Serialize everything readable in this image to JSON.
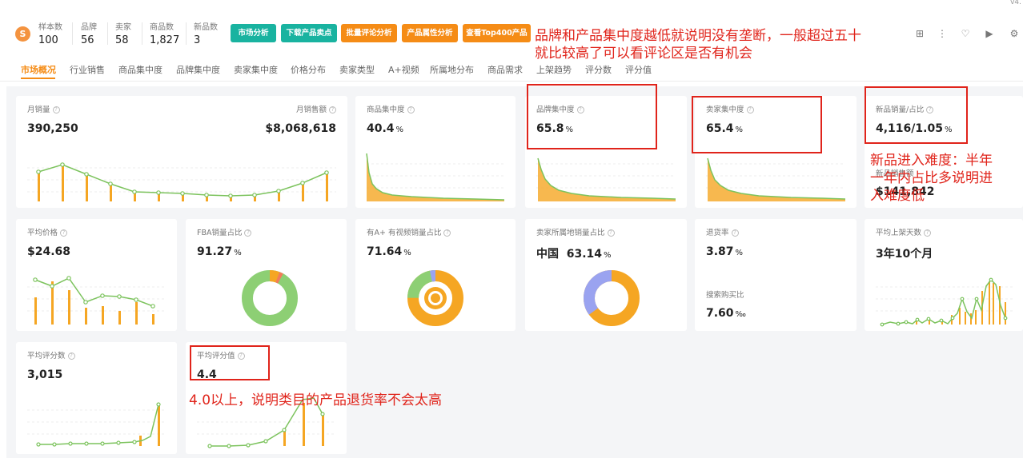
{
  "version": "v4.",
  "header": {
    "stats": [
      {
        "label": "样本数",
        "value": "100"
      },
      {
        "label": "品牌",
        "value": "56"
      },
      {
        "label": "卖家",
        "value": "58"
      },
      {
        "label": "商品数",
        "value": "1,827"
      },
      {
        "label": "新品数",
        "value": "3"
      }
    ],
    "buttons": [
      {
        "label": "市场分析",
        "color": "#19b3a0"
      },
      {
        "label": "下载产品卖点",
        "color": "#19b3a0"
      },
      {
        "label": "批量评论分析",
        "color": "#f58c16"
      },
      {
        "label": "产品属性分析",
        "color": "#f58c16"
      },
      {
        "label": "查看Top400产品",
        "color": "#f58c16"
      }
    ],
    "toolbar_icons": [
      "grid-icon",
      "more-icon",
      "heart-icon",
      "play-icon",
      "settings-icon"
    ]
  },
  "tabs": [
    "市场概况",
    "行业销售",
    "商品集中度",
    "品牌集中度",
    "卖家集中度",
    "价格分布",
    "卖家类型",
    "A+视频",
    "所属地分布",
    "商品需求",
    "上架趋势",
    "评分数",
    "评分值"
  ],
  "cards": {
    "monthly_sales": {
      "title": "月销量",
      "value": "390,250",
      "title2": "月销售额",
      "value2": "$8,068,618"
    },
    "product_concentration": {
      "title": "商品集中度",
      "value": "40.4",
      "unit": "%"
    },
    "brand_concentration": {
      "title": "品牌集中度",
      "value": "65.8",
      "unit": "%"
    },
    "seller_concentration": {
      "title": "卖家集中度",
      "value": "65.4",
      "unit": "%"
    },
    "new_product": {
      "title": "新品销量/占比",
      "value": "4,116/1.05",
      "unit": "%",
      "title2": "新品销售额",
      "value2": "$141,842"
    },
    "avg_price": {
      "title": "平均价格",
      "value": "$24.68"
    },
    "fba": {
      "title": "FBA销量占比",
      "value": "91.27",
      "unit": "%"
    },
    "aplus": {
      "title": "有A+ 有视频销量占比",
      "value": "71.64",
      "unit": "%"
    },
    "seller_location": {
      "title": "卖家所属地销量占比",
      "country": "中国",
      "value": "63.14",
      "unit": "%"
    },
    "return_rate": {
      "title": "退货率",
      "value": "3.87",
      "unit": "%",
      "title2": "搜索购买比",
      "value2": "7.60",
      "unit2": "‰"
    },
    "avg_listing_days": {
      "title": "平均上架天数",
      "value": "3年10个月"
    },
    "avg_review_count": {
      "title": "平均评分数",
      "value": "3,015"
    },
    "avg_rating": {
      "title": "平均评分值",
      "value": "4.4"
    }
  },
  "annotations": {
    "top": "品牌和产品集中度越低就说明没有垄断，一般超过五十",
    "top2": "就比较高了可以看评论区是否有机会",
    "right1": "新品进入难度：半年",
    "right2": "一年内占比多说明进",
    "right3": "入难度低",
    "bottom": "4.0以上，说明类目的产品退货率不会太高"
  },
  "colors": {
    "bar": "#f5a623",
    "line": "#7cc35d",
    "accent": "#f58c16",
    "annot": "#e0241b"
  }
}
